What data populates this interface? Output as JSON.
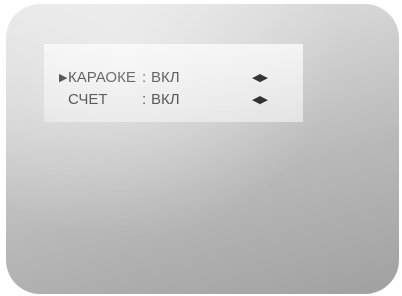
{
  "menu": {
    "cursor_symbol": "▶",
    "items": [
      {
        "label": "КАРАОКЕ",
        "separator": ":",
        "value": "ВКЛ",
        "arrows": "◀▶",
        "selected": true
      },
      {
        "label": "СЧЕТ",
        "separator": ":",
        "value": "ВКЛ",
        "arrows": "◀▶",
        "selected": false
      }
    ]
  },
  "colors": {
    "text": "#111111",
    "panel": "#eeeeee",
    "screen": "#c8c8c8"
  }
}
